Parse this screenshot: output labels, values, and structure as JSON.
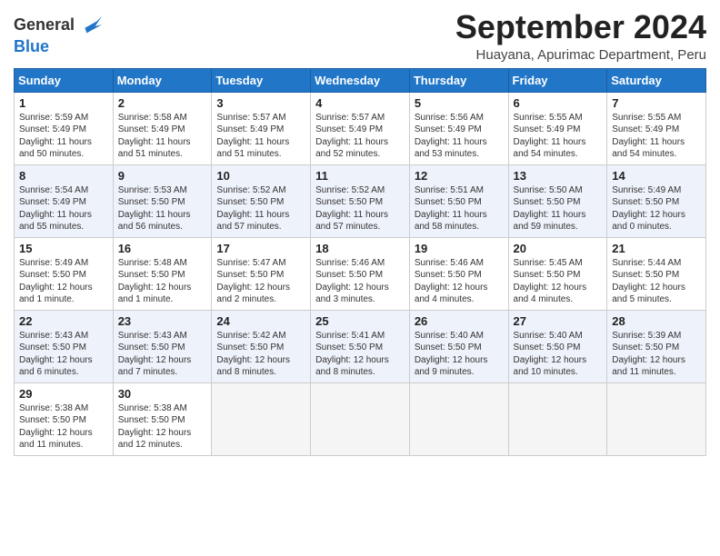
{
  "header": {
    "logo_line1": "General",
    "logo_line2": "Blue",
    "month": "September 2024",
    "location": "Huayana, Apurimac Department, Peru"
  },
  "days_of_week": [
    "Sunday",
    "Monday",
    "Tuesday",
    "Wednesday",
    "Thursday",
    "Friday",
    "Saturday"
  ],
  "weeks": [
    [
      {
        "day": "1",
        "info": "Sunrise: 5:59 AM\nSunset: 5:49 PM\nDaylight: 11 hours\nand 50 minutes."
      },
      {
        "day": "2",
        "info": "Sunrise: 5:58 AM\nSunset: 5:49 PM\nDaylight: 11 hours\nand 51 minutes."
      },
      {
        "day": "3",
        "info": "Sunrise: 5:57 AM\nSunset: 5:49 PM\nDaylight: 11 hours\nand 51 minutes."
      },
      {
        "day": "4",
        "info": "Sunrise: 5:57 AM\nSunset: 5:49 PM\nDaylight: 11 hours\nand 52 minutes."
      },
      {
        "day": "5",
        "info": "Sunrise: 5:56 AM\nSunset: 5:49 PM\nDaylight: 11 hours\nand 53 minutes."
      },
      {
        "day": "6",
        "info": "Sunrise: 5:55 AM\nSunset: 5:49 PM\nDaylight: 11 hours\nand 54 minutes."
      },
      {
        "day": "7",
        "info": "Sunrise: 5:55 AM\nSunset: 5:49 PM\nDaylight: 11 hours\nand 54 minutes."
      }
    ],
    [
      {
        "day": "8",
        "info": "Sunrise: 5:54 AM\nSunset: 5:49 PM\nDaylight: 11 hours\nand 55 minutes."
      },
      {
        "day": "9",
        "info": "Sunrise: 5:53 AM\nSunset: 5:50 PM\nDaylight: 11 hours\nand 56 minutes."
      },
      {
        "day": "10",
        "info": "Sunrise: 5:52 AM\nSunset: 5:50 PM\nDaylight: 11 hours\nand 57 minutes."
      },
      {
        "day": "11",
        "info": "Sunrise: 5:52 AM\nSunset: 5:50 PM\nDaylight: 11 hours\nand 57 minutes."
      },
      {
        "day": "12",
        "info": "Sunrise: 5:51 AM\nSunset: 5:50 PM\nDaylight: 11 hours\nand 58 minutes."
      },
      {
        "day": "13",
        "info": "Sunrise: 5:50 AM\nSunset: 5:50 PM\nDaylight: 11 hours\nand 59 minutes."
      },
      {
        "day": "14",
        "info": "Sunrise: 5:49 AM\nSunset: 5:50 PM\nDaylight: 12 hours\nand 0 minutes."
      }
    ],
    [
      {
        "day": "15",
        "info": "Sunrise: 5:49 AM\nSunset: 5:50 PM\nDaylight: 12 hours\nand 1 minute."
      },
      {
        "day": "16",
        "info": "Sunrise: 5:48 AM\nSunset: 5:50 PM\nDaylight: 12 hours\nand 1 minute."
      },
      {
        "day": "17",
        "info": "Sunrise: 5:47 AM\nSunset: 5:50 PM\nDaylight: 12 hours\nand 2 minutes."
      },
      {
        "day": "18",
        "info": "Sunrise: 5:46 AM\nSunset: 5:50 PM\nDaylight: 12 hours\nand 3 minutes."
      },
      {
        "day": "19",
        "info": "Sunrise: 5:46 AM\nSunset: 5:50 PM\nDaylight: 12 hours\nand 4 minutes."
      },
      {
        "day": "20",
        "info": "Sunrise: 5:45 AM\nSunset: 5:50 PM\nDaylight: 12 hours\nand 4 minutes."
      },
      {
        "day": "21",
        "info": "Sunrise: 5:44 AM\nSunset: 5:50 PM\nDaylight: 12 hours\nand 5 minutes."
      }
    ],
    [
      {
        "day": "22",
        "info": "Sunrise: 5:43 AM\nSunset: 5:50 PM\nDaylight: 12 hours\nand 6 minutes."
      },
      {
        "day": "23",
        "info": "Sunrise: 5:43 AM\nSunset: 5:50 PM\nDaylight: 12 hours\nand 7 minutes."
      },
      {
        "day": "24",
        "info": "Sunrise: 5:42 AM\nSunset: 5:50 PM\nDaylight: 12 hours\nand 8 minutes."
      },
      {
        "day": "25",
        "info": "Sunrise: 5:41 AM\nSunset: 5:50 PM\nDaylight: 12 hours\nand 8 minutes."
      },
      {
        "day": "26",
        "info": "Sunrise: 5:40 AM\nSunset: 5:50 PM\nDaylight: 12 hours\nand 9 minutes."
      },
      {
        "day": "27",
        "info": "Sunrise: 5:40 AM\nSunset: 5:50 PM\nDaylight: 12 hours\nand 10 minutes."
      },
      {
        "day": "28",
        "info": "Sunrise: 5:39 AM\nSunset: 5:50 PM\nDaylight: 12 hours\nand 11 minutes."
      }
    ],
    [
      {
        "day": "29",
        "info": "Sunrise: 5:38 AM\nSunset: 5:50 PM\nDaylight: 12 hours\nand 11 minutes."
      },
      {
        "day": "30",
        "info": "Sunrise: 5:38 AM\nSunset: 5:50 PM\nDaylight: 12 hours\nand 12 minutes."
      },
      {
        "day": "",
        "info": ""
      },
      {
        "day": "",
        "info": ""
      },
      {
        "day": "",
        "info": ""
      },
      {
        "day": "",
        "info": ""
      },
      {
        "day": "",
        "info": ""
      }
    ]
  ]
}
